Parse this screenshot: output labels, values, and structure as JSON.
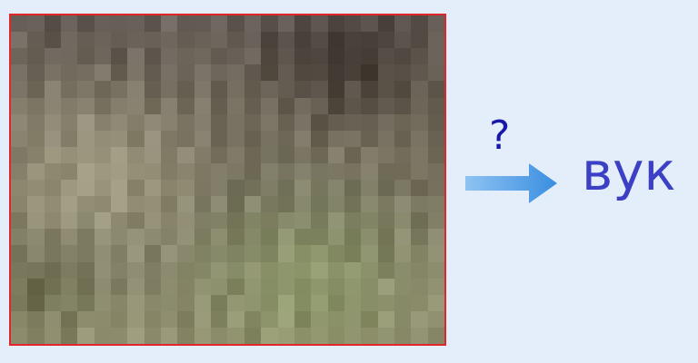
{
  "prompt": {
    "question": "?",
    "word": "вук"
  },
  "colors": {
    "background": "#e4eefa",
    "image_border": "#e2252a",
    "question_mark": "#1818a8",
    "answer_word": "#3c40c4",
    "arrow_light": "#8ec3f2",
    "arrow_dark": "#3a8ee0"
  },
  "image": {
    "description_icon": "pixelated-photo",
    "palette": [
      "#6e6a62",
      "#7a7468",
      "#857e70",
      "#8f8a78",
      "#9a9680",
      "#a6a488",
      "#8e9a78",
      "#7f7a6c",
      "#6a655c",
      "#97a083"
    ]
  }
}
